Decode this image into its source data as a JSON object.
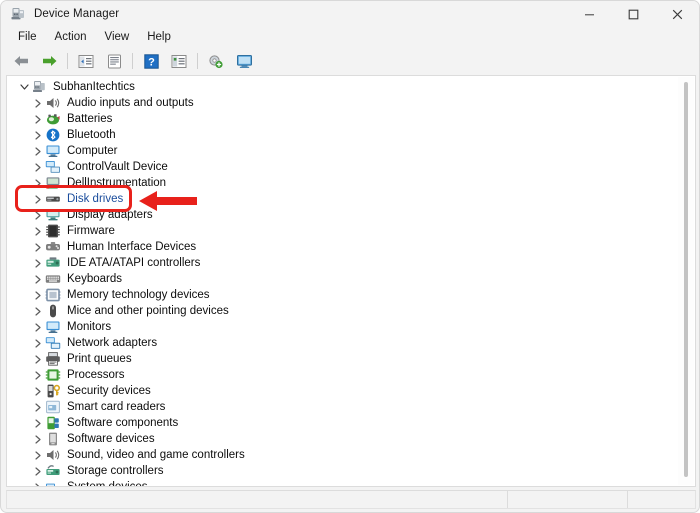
{
  "window": {
    "title": "Device Manager",
    "title_icon": "device-manager-icon",
    "controls": {
      "minimize": "minimize-icon",
      "maximize": "maximize-icon",
      "close": "close-icon"
    }
  },
  "menubar": {
    "items": [
      {
        "label": "File"
      },
      {
        "label": "Action"
      },
      {
        "label": "View"
      },
      {
        "label": "Help"
      }
    ]
  },
  "toolbar": {
    "buttons": [
      {
        "name": "back-arrow-icon",
        "type": "icon"
      },
      {
        "name": "forward-arrow-icon",
        "type": "icon"
      },
      {
        "name": "separator",
        "type": "sep"
      },
      {
        "name": "show-hide-console-tree-icon",
        "type": "icon"
      },
      {
        "name": "properties-icon",
        "type": "icon"
      },
      {
        "name": "separator",
        "type": "sep"
      },
      {
        "name": "help-icon",
        "type": "icon"
      },
      {
        "name": "update-driver-icon",
        "type": "icon"
      },
      {
        "name": "separator",
        "type": "sep"
      },
      {
        "name": "scan-for-hardware-changes-icon",
        "type": "icon"
      },
      {
        "name": "display-device-icon",
        "type": "icon"
      }
    ]
  },
  "tree": {
    "root": {
      "label": "SubhanItechtics",
      "expanded": true,
      "icon": "computer-node-icon"
    },
    "items": [
      {
        "label": "Audio inputs and outputs",
        "icon": "speaker-icon",
        "icon_color": "#6d6d6d"
      },
      {
        "label": "Batteries",
        "icon": "battery-icon",
        "icon_color": "#3f9c35"
      },
      {
        "label": "Bluetooth",
        "icon": "bluetooth-icon",
        "icon_color": "#1673c8"
      },
      {
        "label": "Computer",
        "icon": "monitor-icon",
        "icon_color": "#3a8fd4"
      },
      {
        "label": "ControlVault Device",
        "icon": "network-device-icon",
        "icon_color": "#3a8fd4"
      },
      {
        "label": "DellInstrumentation",
        "icon": "instrumentation-icon",
        "icon_color": "#4aa05a"
      },
      {
        "label": "Disk drives",
        "icon": "disk-drive-icon",
        "icon_color": "#4a4a4a",
        "highlight": true
      },
      {
        "label": "Display adapters",
        "icon": "display-adapter-icon",
        "icon_color": "#4a9a9a"
      },
      {
        "label": "Firmware",
        "icon": "firmware-chip-icon",
        "icon_color": "#4b4b4b"
      },
      {
        "label": "Human Interface Devices",
        "icon": "hid-icon",
        "icon_color": "#7d7d7d"
      },
      {
        "label": "IDE ATA/ATAPI controllers",
        "icon": "ide-controller-icon",
        "icon_color": "#3f9c7a"
      },
      {
        "label": "Keyboards",
        "icon": "keyboard-icon",
        "icon_color": "#7d7d7d"
      },
      {
        "label": "Memory technology devices",
        "icon": "memory-icon",
        "icon_color": "#7d91a8"
      },
      {
        "label": "Mice and other pointing devices",
        "icon": "mouse-icon",
        "icon_color": "#4a4a4a"
      },
      {
        "label": "Monitors",
        "icon": "monitor-icon",
        "icon_color": "#3a8fd4"
      },
      {
        "label": "Network adapters",
        "icon": "network-adapter-icon",
        "icon_color": "#3a8fd4"
      },
      {
        "label": "Print queues",
        "icon": "printer-icon",
        "icon_color": "#5c5c5c"
      },
      {
        "label": "Processors",
        "icon": "processor-icon",
        "icon_color": "#3f9c35"
      },
      {
        "label": "Security devices",
        "icon": "security-key-icon",
        "icon_color": "#4a4a4a"
      },
      {
        "label": "Smart card readers",
        "icon": "smart-card-reader-icon",
        "icon_color": "#8fb8d8"
      },
      {
        "label": "Software components",
        "icon": "software-component-icon",
        "icon_color": "#3f9c35"
      },
      {
        "label": "Software devices",
        "icon": "software-device-icon",
        "icon_color": "#8a8a8a"
      },
      {
        "label": "Sound, video and game controllers",
        "icon": "sound-controller-icon",
        "icon_color": "#6d6d6d"
      },
      {
        "label": "Storage controllers",
        "icon": "storage-controller-icon",
        "icon_color": "#3f9c7a"
      },
      {
        "label": "System devices",
        "icon": "system-device-icon",
        "icon_color": "#3a8fd4"
      }
    ]
  },
  "annotations": {
    "highlight_box": {
      "target": "Disk drives",
      "color": "#e8211b",
      "shape": "rounded-rectangle"
    },
    "arrow": {
      "direction": "left",
      "color": "#e8211b",
      "points_to": "Disk drives"
    }
  },
  "statusbar": {
    "segments": [
      "",
      "",
      ""
    ]
  }
}
